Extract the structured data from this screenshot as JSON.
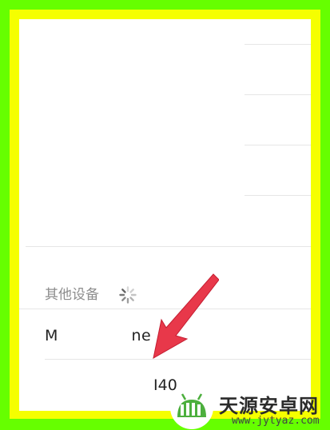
{
  "other_devices": {
    "section_label": "其他设备",
    "devices": [
      {
        "name": "M              ne"
      },
      {
        "name": "I40"
      }
    ]
  },
  "watermark": {
    "site_name": "天源安卓网",
    "url": "www.jytyaz.com"
  },
  "colors": {
    "outer_frame": "#66ff00",
    "inner_frame": "#f5ff00",
    "arrow": "#e8384a",
    "watermark_green": "#4caf3d"
  }
}
